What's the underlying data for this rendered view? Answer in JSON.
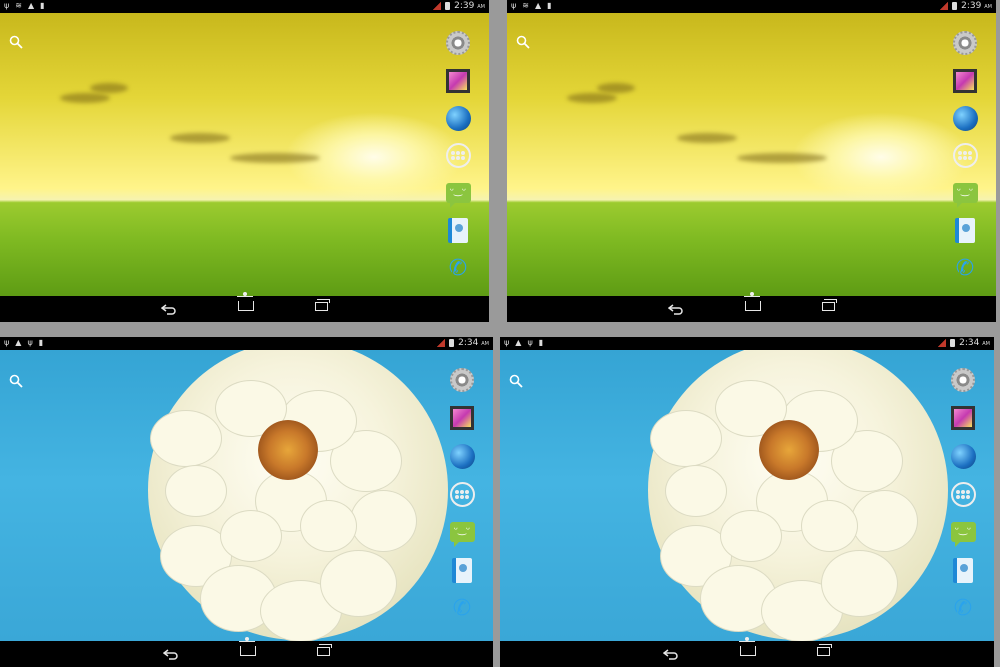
{
  "screens": [
    {
      "id": "s1",
      "time": "2:39",
      "ampm": "AM",
      "wallpaper": "sunset-field"
    },
    {
      "id": "s2",
      "time": "2:39",
      "ampm": "AM",
      "wallpaper": "sunset-field"
    },
    {
      "id": "s3",
      "time": "2:34",
      "ampm": "AM",
      "wallpaper": "white-flower"
    },
    {
      "id": "s4",
      "time": "2:34",
      "ampm": "AM",
      "wallpaper": "white-flower"
    }
  ],
  "dock_icons": [
    "settings-icon",
    "gallery-icon",
    "browser-icon",
    "all-apps-icon",
    "messaging-icon",
    "contacts-icon",
    "phone-icon"
  ],
  "nav_buttons": [
    "back-icon",
    "home-icon",
    "recent-apps-icon"
  ],
  "status_icons_left": [
    "usb-icon",
    "wifi-icon",
    "warning-icon",
    "battery-full-icon"
  ],
  "colors": {
    "accent_phone": "#2aa3ec",
    "messaging": "#8bc53f",
    "signal": "#c0392b",
    "sky": "#3aa7d7"
  }
}
